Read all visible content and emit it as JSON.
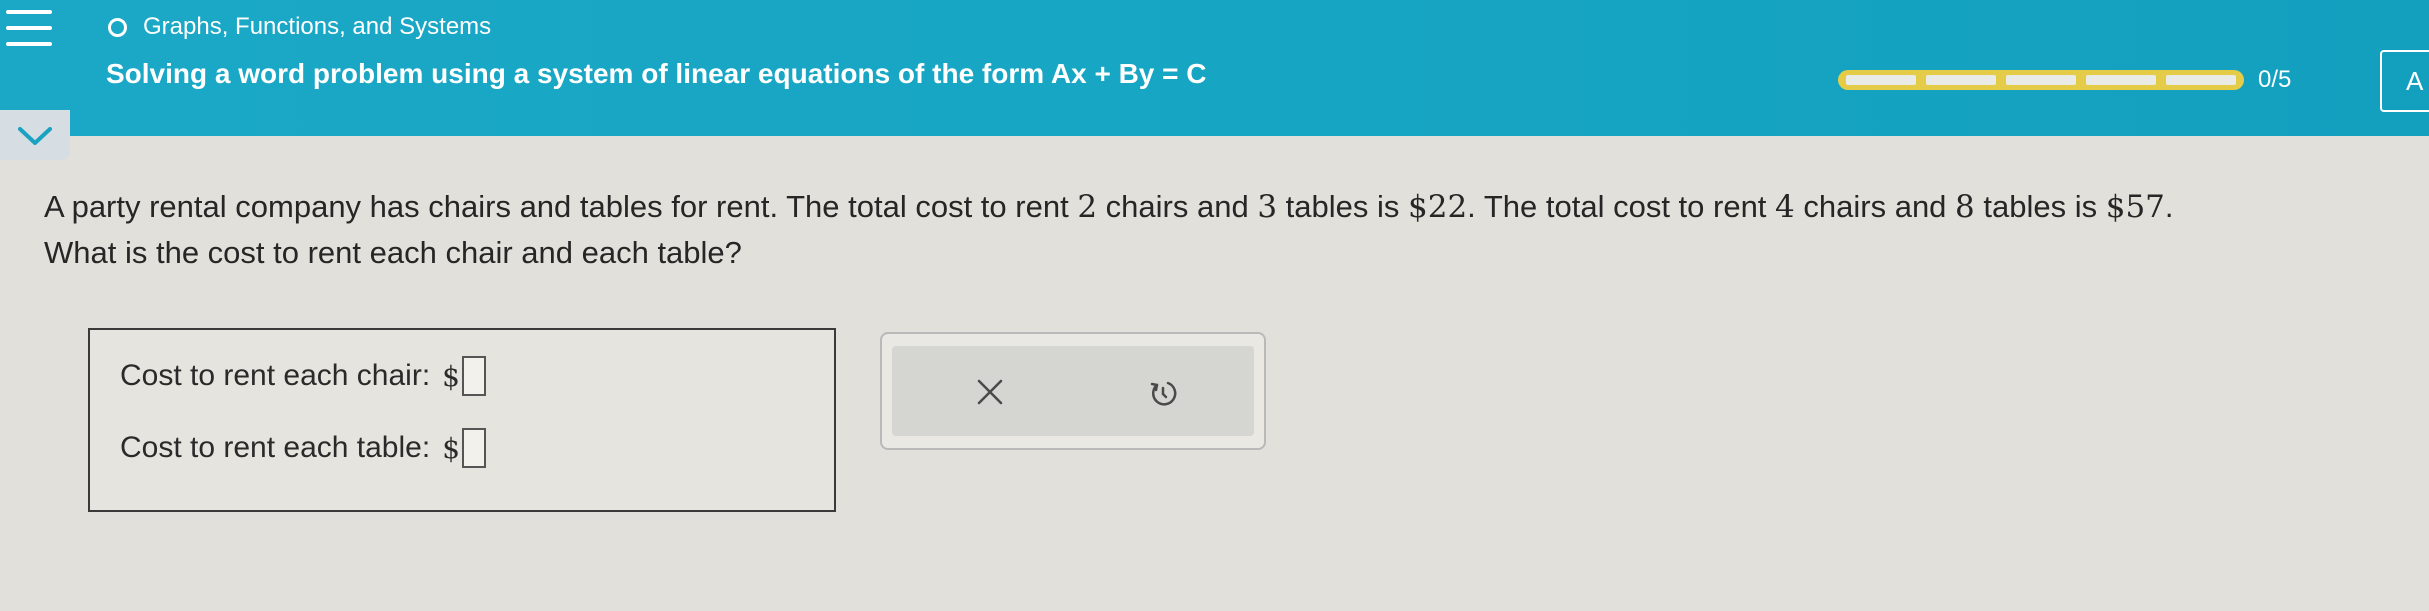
{
  "header": {
    "topic": "Graphs, Functions, and Systems",
    "title": "Solving a word problem using a system of linear equations of the form Ax + By = C",
    "progress": {
      "count_text": "0/5",
      "completed": 0,
      "total": 5,
      "bar_color": "#e5cc48"
    },
    "account_initial": "A"
  },
  "question": {
    "line1_parts": [
      "A party rental company has chairs and tables for rent. The total cost to rent ",
      "2",
      " chairs and ",
      "3",
      " tables is ",
      "$22",
      ". The total cost to rent ",
      "4",
      " chairs and ",
      "8",
      " tables is ",
      "$57",
      "."
    ],
    "line2": "What is the cost to rent each chair and each table?"
  },
  "answers": {
    "chair_label": "Cost to rent each chair:",
    "table_label": "Cost to rent each table:",
    "currency": "$",
    "chair_value": "",
    "table_value": ""
  },
  "actions": {
    "clear_icon": "x-icon",
    "reset_icon": "undo-icon"
  },
  "colors": {
    "header_accent": "#16a5c3",
    "background": "#e2e0da"
  }
}
